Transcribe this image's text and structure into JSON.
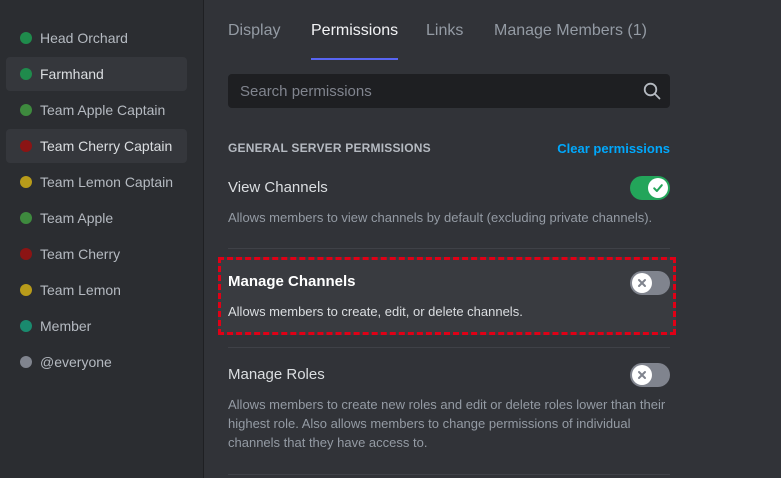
{
  "sidebar": {
    "roles": [
      {
        "label": "Head Orchard",
        "color": "#1f8b4c"
      },
      {
        "label": "Farmhand",
        "color": "#1f8b4c",
        "selected": true
      },
      {
        "label": "Team Apple Captain",
        "color": "#3e8a3e"
      },
      {
        "label": "Team Cherry Captain",
        "color": "#8b1414",
        "selected": true
      },
      {
        "label": "Team Lemon Captain",
        "color": "#b89b1a"
      },
      {
        "label": "Team Apple",
        "color": "#3e8a3e"
      },
      {
        "label": "Team Cherry",
        "color": "#8b1414"
      },
      {
        "label": "Team Lemon",
        "color": "#b89b1a"
      },
      {
        "label": "Member",
        "color": "#1a8a6e"
      },
      {
        "label": "@everyone",
        "color": "#80848e"
      }
    ]
  },
  "tabs": [
    {
      "label": "Display"
    },
    {
      "label": "Permissions",
      "active": true
    },
    {
      "label": "Links"
    },
    {
      "label": "Manage Members (1)"
    }
  ],
  "search": {
    "placeholder": "Search permissions",
    "value": ""
  },
  "section": {
    "title": "GENERAL SERVER PERMISSIONS",
    "clear_label": "Clear permissions"
  },
  "permissions": [
    {
      "title": "View Channels",
      "description": "Allows members to view channels by default (excluding private channels).",
      "enabled": true
    },
    {
      "title": "Manage Channels",
      "description": "Allows members to create, edit, or delete channels.",
      "enabled": false,
      "highlighted": true
    },
    {
      "title": "Manage Roles",
      "description": "Allows members to create new roles and edit or delete roles lower than their highest role. Also allows members to change permissions of individual channels that they have access to.",
      "enabled": false
    }
  ],
  "colors": {
    "accent": "#5865f2",
    "toggle_on": "#23a55a",
    "toggle_off": "#80848e",
    "link": "#00a8fc",
    "highlight_border": "#e00016"
  }
}
